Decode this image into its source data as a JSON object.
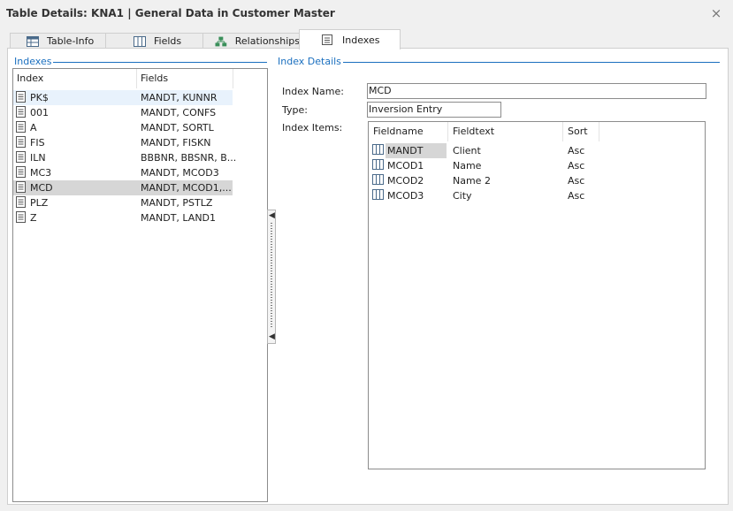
{
  "window": {
    "title": "Table Details: KNA1 | General Data in Customer Master",
    "close_glyph": "×"
  },
  "tabs": [
    {
      "label": "Table-Info",
      "icon": "table-icon"
    },
    {
      "label": "Fields",
      "icon": "columns-icon"
    },
    {
      "label": "Relationships",
      "icon": "relationships-icon"
    },
    {
      "label": "Indexes",
      "icon": "index-icon",
      "active": true
    }
  ],
  "indexes_group": {
    "title": "Indexes",
    "columns": [
      "Index",
      "Fields"
    ],
    "rows": [
      {
        "index": "PK$",
        "fields": "MANDT, KUNNR"
      },
      {
        "index": "001",
        "fields": "MANDT, CONFS"
      },
      {
        "index": "A",
        "fields": "MANDT, SORTL"
      },
      {
        "index": "FIS",
        "fields": "MANDT, FISKN"
      },
      {
        "index": "ILN",
        "fields": "BBBNR, BBSNR, B..."
      },
      {
        "index": "MC3",
        "fields": "MANDT, MCOD3"
      },
      {
        "index": "MCD",
        "fields": "MANDT, MCOD1,..."
      },
      {
        "index": "PLZ",
        "fields": "MANDT, PSTLZ"
      },
      {
        "index": "Z",
        "fields": "MANDT, LAND1"
      }
    ]
  },
  "details_group": {
    "title": "Index Details",
    "index_name_label": "Index Name:",
    "index_name_value": "MCD",
    "type_label": "Type:",
    "type_value": "Inversion Entry",
    "items_label": "Index Items:",
    "items_columns": [
      "Fieldname",
      "Fieldtext",
      "Sort"
    ],
    "items": [
      {
        "fieldname": "MANDT",
        "fieldtext": "Client",
        "sort": "Asc"
      },
      {
        "fieldname": "MCOD1",
        "fieldtext": "Name",
        "sort": "Asc"
      },
      {
        "fieldname": "MCOD2",
        "fieldtext": "Name 2",
        "sort": "Asc"
      },
      {
        "fieldname": "MCOD3",
        "fieldtext": "City",
        "sort": "Asc"
      }
    ]
  },
  "colors": {
    "accent": "#1a6fbf",
    "selected_row": "#d6d6d6",
    "hover_row": "#e8f2fc"
  }
}
